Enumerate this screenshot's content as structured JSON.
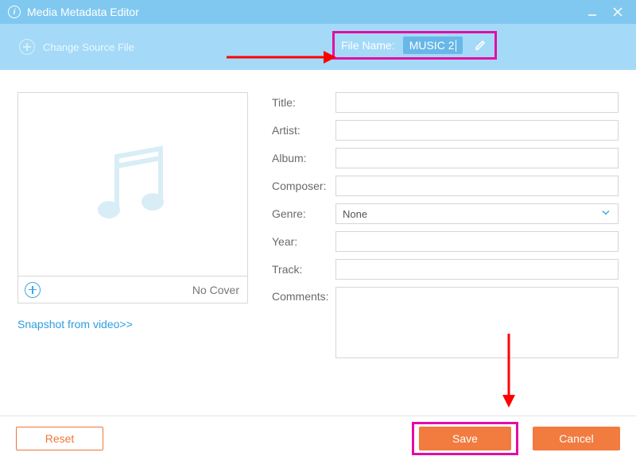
{
  "window": {
    "title": "Media Metadata Editor"
  },
  "toolbar": {
    "change_source_label": "Change Source File",
    "file_name_label": "File Name:",
    "file_name_value": "MUSIC 2"
  },
  "cover": {
    "no_cover_label": "No Cover",
    "snapshot_link": "Snapshot from video>>"
  },
  "form": {
    "title_label": "Title:",
    "artist_label": "Artist:",
    "album_label": "Album:",
    "composer_label": "Composer:",
    "genre_label": "Genre:",
    "genre_value": "None",
    "year_label": "Year:",
    "track_label": "Track:",
    "comments_label": "Comments:",
    "values": {
      "title": "",
      "artist": "",
      "album": "",
      "composer": "",
      "year": "",
      "track": "",
      "comments": ""
    }
  },
  "footer": {
    "reset_label": "Reset",
    "save_label": "Save",
    "cancel_label": "Cancel"
  },
  "annotations": {
    "arrow_color": "#ff0000",
    "highlight_color": "#e40ca6"
  }
}
